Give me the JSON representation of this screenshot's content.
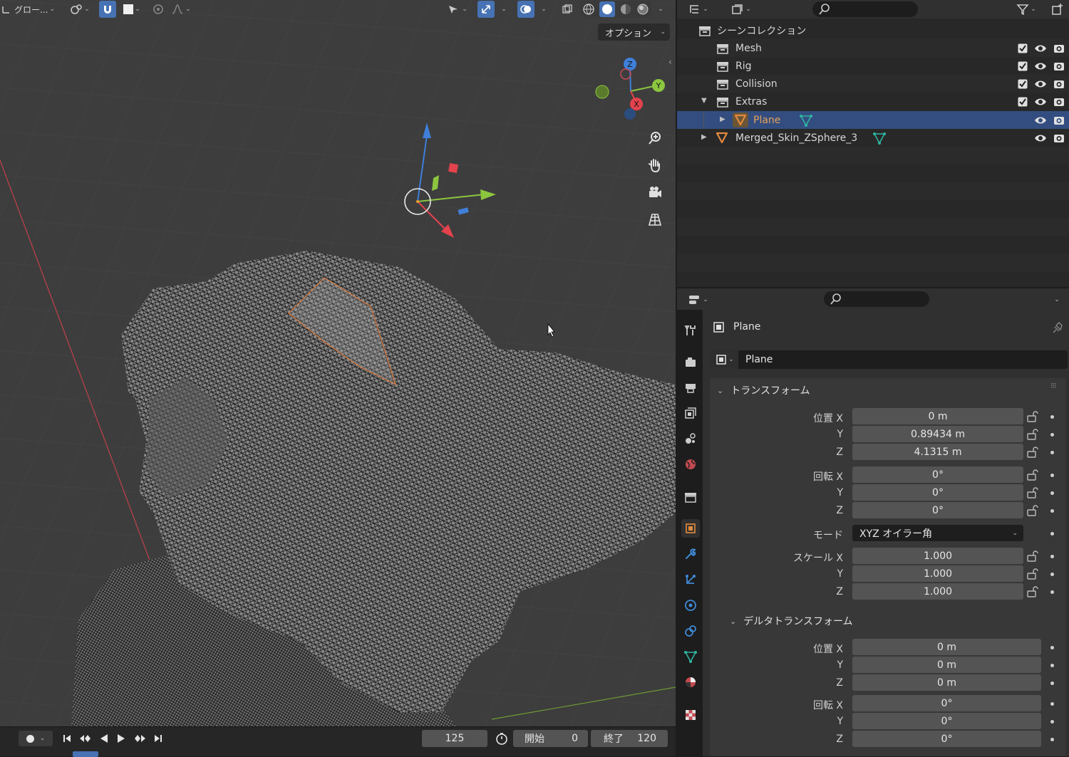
{
  "viewport": {
    "header": {
      "transform_orientation_label": "グロー...",
      "options_label": "オプション"
    },
    "gizmo_axes": {
      "x": "X",
      "y": "Y",
      "z": "Z"
    },
    "nav_buttons": [
      "zoom-icon",
      "hand-pan-icon",
      "camera-icon",
      "grid-perspective-icon"
    ]
  },
  "timeline": {
    "current_frame": "125",
    "start_label": "開始",
    "start_value": "0",
    "end_label": "終了",
    "end_value": "120"
  },
  "outliner": {
    "root": "シーンコレクション",
    "items": [
      {
        "label": "Mesh",
        "type": "collection",
        "checked": true
      },
      {
        "label": "Rig",
        "type": "collection",
        "checked": true
      },
      {
        "label": "Collision",
        "type": "collection",
        "checked": true
      },
      {
        "label": "Extras",
        "type": "collection",
        "checked": true,
        "expanded": true
      },
      {
        "label": "Plane",
        "type": "object",
        "selected": true
      },
      {
        "label": "Merged_Skin_ZSphere_3",
        "type": "object"
      }
    ]
  },
  "properties": {
    "object_name_header": "Plane",
    "object_name_field": "Plane",
    "transform": {
      "title": "トランスフォーム",
      "location_label": "位置 X",
      "location": [
        "0 m",
        "0.89434 m",
        "4.1315 m"
      ],
      "rotation_label": "回転 X",
      "rotation": [
        "0°",
        "0°",
        "0°"
      ],
      "mode_label": "モード",
      "mode_value": "XYZ オイラー角",
      "scale_label": "スケール X",
      "scale": [
        "1.000",
        "1.000",
        "1.000"
      ],
      "y_label": "Y",
      "z_label": "Z"
    },
    "delta_transform": {
      "title": "デルタトランスフォーム",
      "location_label": "位置 X",
      "location": [
        "0 m",
        "0 m",
        "0 m"
      ],
      "rotation_label": "回転 X",
      "rotation": [
        "0°",
        "0°",
        "0°"
      ]
    }
  },
  "colors": {
    "accent_blue": "#4772b3",
    "selection_row": "#334d80",
    "axis_x": "#e2434d",
    "axis_y": "#8cc63f",
    "axis_z": "#3f7fd9",
    "object_orange": "#e38b3d",
    "mesh_data_teal": "#2fb5a0"
  }
}
